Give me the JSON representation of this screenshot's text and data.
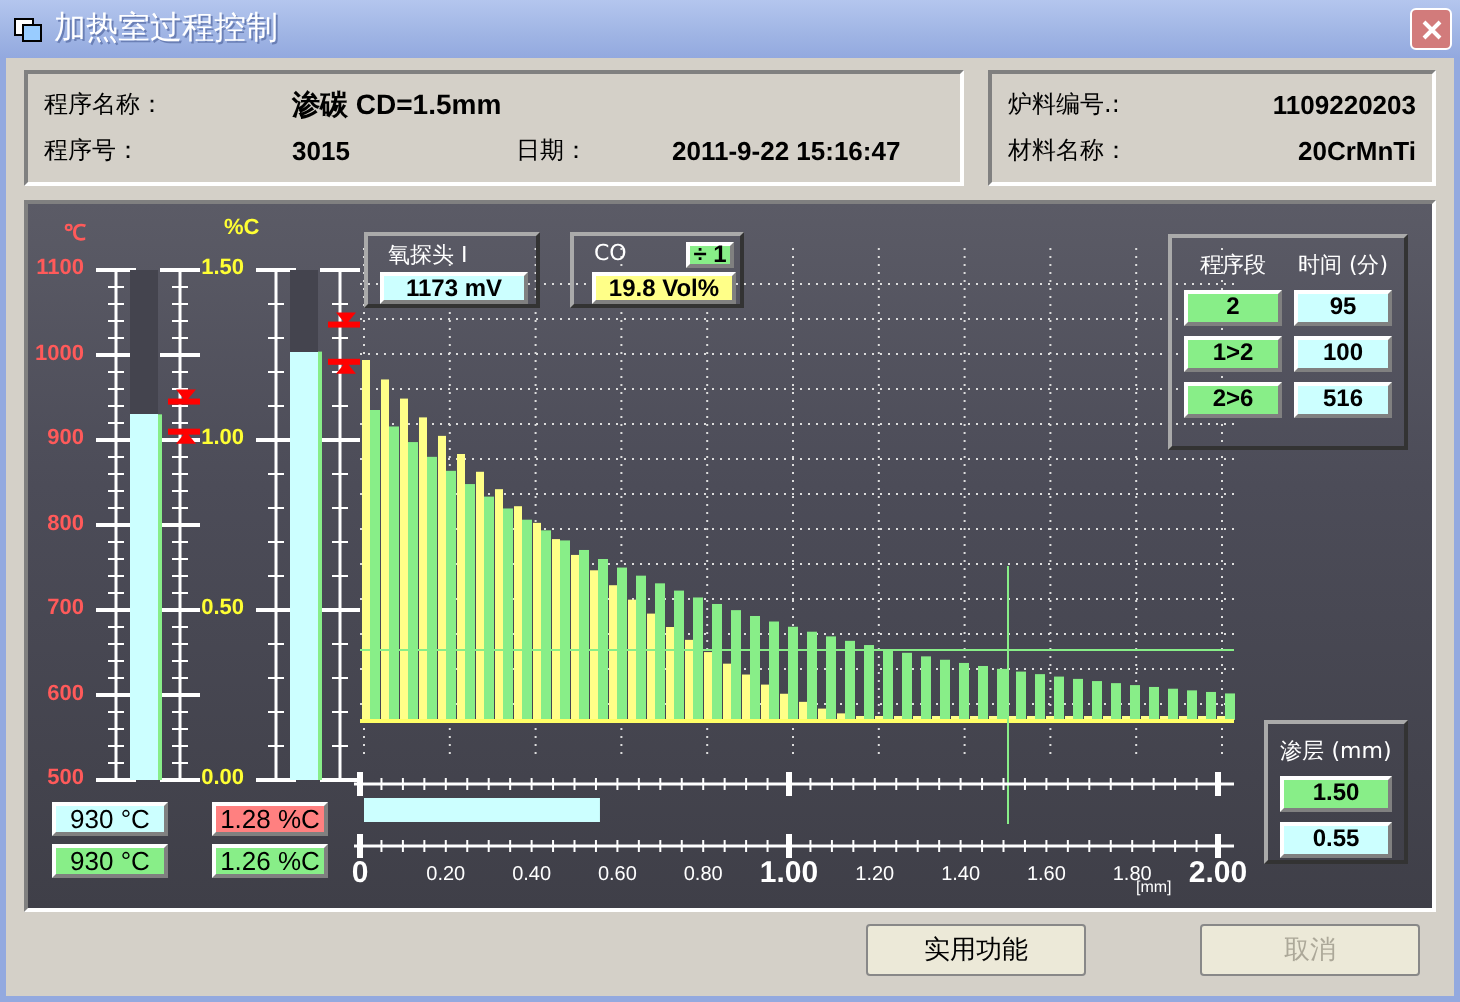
{
  "window": {
    "title": "加热室过程控制"
  },
  "program": {
    "name_label": "程序名称：",
    "name": "渗碳 CD=1.5mm",
    "number_label": "程序号：",
    "number": "3015",
    "date_label": "日期：",
    "date": "2011-9-22 15:16:47"
  },
  "batch": {
    "fields": [
      {
        "label": "炉料编号.:",
        "value": "1109220203"
      },
      {
        "label": "材料名称：",
        "value": "20CrMnTi"
      }
    ]
  },
  "temperature_gauge": {
    "unit": "℃",
    "scale": [
      "1100",
      "1000",
      "900",
      "800",
      "700",
      "600",
      "500"
    ],
    "level": 0.717,
    "readouts": [
      {
        "value": "930 °C",
        "color": "#ccffff"
      },
      {
        "value": "930 °C",
        "color": "#88ee88"
      }
    ]
  },
  "carbon_gauge": {
    "unit": "%C",
    "scale": [
      "1.50",
      "1.00",
      "0.50",
      "0.00"
    ],
    "level": 0.84,
    "readouts": [
      {
        "value": "1.28 %C",
        "color": "#ff8080"
      },
      {
        "value": "1.26 %C",
        "color": "#88ee88"
      }
    ]
  },
  "oxygen_probe": {
    "label": "氧探头 I",
    "value": "1173 mV"
  },
  "co": {
    "label": "CO",
    "divisor": "÷ 1",
    "value": "19.8 Vol%"
  },
  "segments": {
    "headers": [
      "程序段",
      "时间 (分)"
    ],
    "rows": [
      {
        "segment": "2",
        "time": "95"
      },
      {
        "segment": "1>2",
        "time": "100"
      },
      {
        "segment": "2>6",
        "time": "516"
      }
    ]
  },
  "depth_axis": {
    "labels": [
      "0",
      "0.20",
      "0.40",
      "0.60",
      "0.80",
      "1.00",
      "1.20",
      "1.40",
      "1.60",
      "1.80",
      "2.00"
    ],
    "unit": "[mm]",
    "level": 0.275
  },
  "layer": {
    "title": "渗层 (mm)",
    "values": [
      {
        "value": "1.50",
        "color": "#88ee88"
      },
      {
        "value": "0.55",
        "color": "#ccffff"
      }
    ]
  },
  "buttons": [
    {
      "label": "实用功能",
      "disabled": false
    },
    {
      "label": "取消",
      "disabled": true
    }
  ]
}
